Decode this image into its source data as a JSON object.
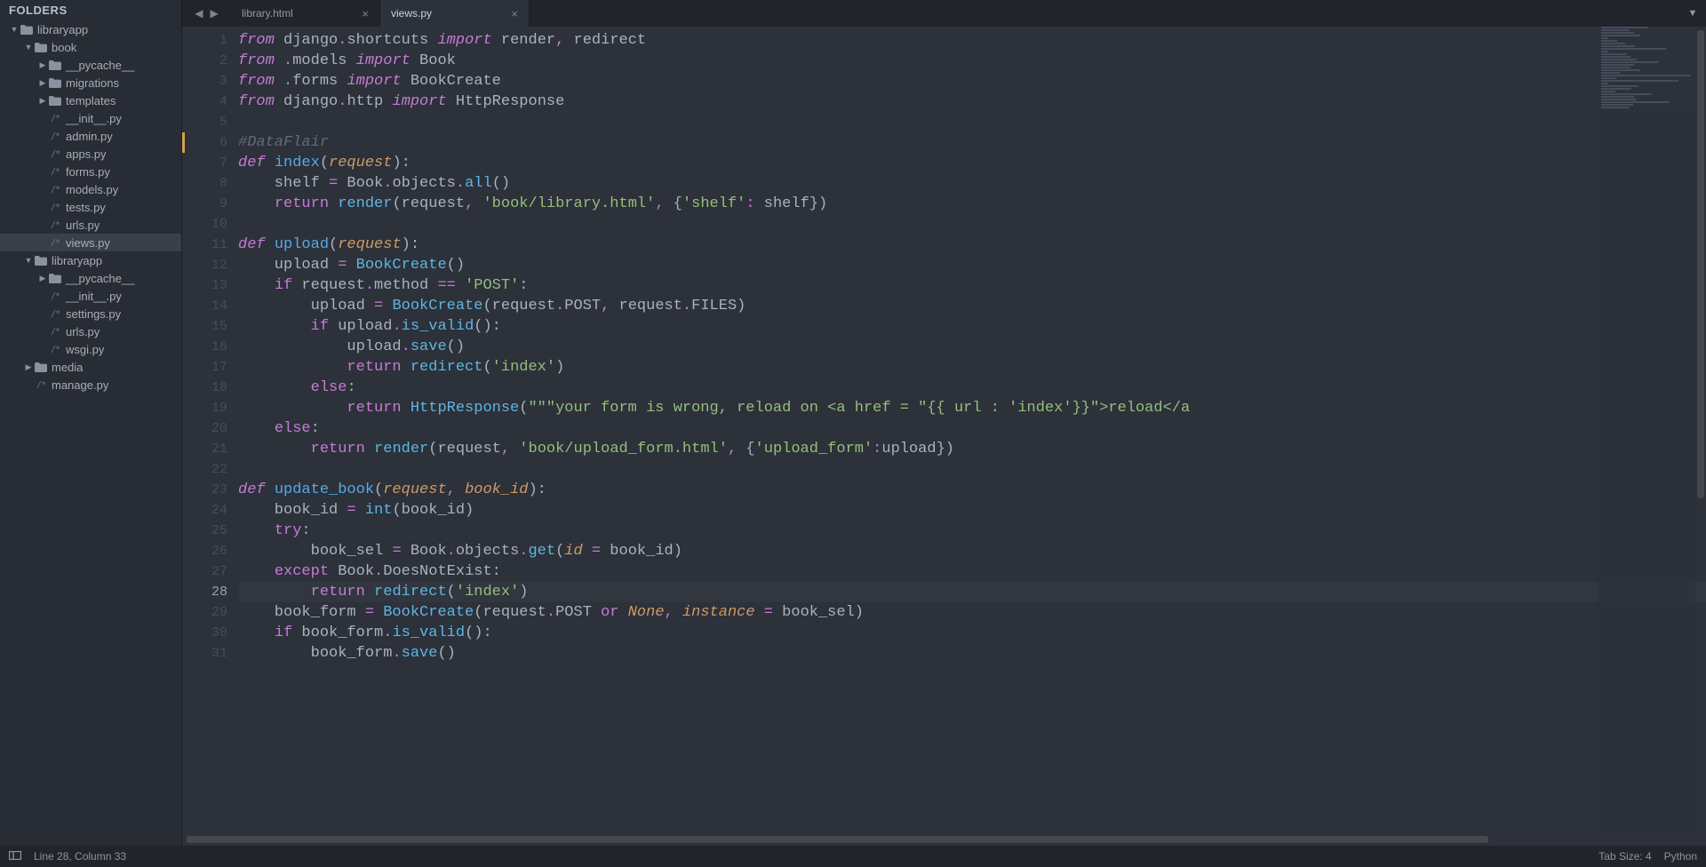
{
  "sidebar": {
    "header": "FOLDERS",
    "tree": [
      {
        "depth": 0,
        "type": "folder",
        "open": true,
        "name": "libraryapp"
      },
      {
        "depth": 1,
        "type": "folder",
        "open": true,
        "name": "book"
      },
      {
        "depth": 2,
        "type": "folder",
        "open": false,
        "name": "__pycache__"
      },
      {
        "depth": 2,
        "type": "folder",
        "open": false,
        "name": "migrations"
      },
      {
        "depth": 2,
        "type": "folder",
        "open": false,
        "name": "templates"
      },
      {
        "depth": 2,
        "type": "file",
        "name": "__init__.py"
      },
      {
        "depth": 2,
        "type": "file",
        "name": "admin.py"
      },
      {
        "depth": 2,
        "type": "file",
        "name": "apps.py"
      },
      {
        "depth": 2,
        "type": "file",
        "name": "forms.py"
      },
      {
        "depth": 2,
        "type": "file",
        "name": "models.py"
      },
      {
        "depth": 2,
        "type": "file",
        "name": "tests.py"
      },
      {
        "depth": 2,
        "type": "file",
        "name": "urls.py"
      },
      {
        "depth": 2,
        "type": "file",
        "name": "views.py",
        "selected": true
      },
      {
        "depth": 1,
        "type": "folder",
        "open": true,
        "name": "libraryapp"
      },
      {
        "depth": 2,
        "type": "folder",
        "open": false,
        "name": "__pycache__"
      },
      {
        "depth": 2,
        "type": "file",
        "name": "__init__.py"
      },
      {
        "depth": 2,
        "type": "file",
        "name": "settings.py"
      },
      {
        "depth": 2,
        "type": "file",
        "name": "urls.py"
      },
      {
        "depth": 2,
        "type": "file",
        "name": "wsgi.py"
      },
      {
        "depth": 1,
        "type": "folder",
        "open": false,
        "name": "media"
      },
      {
        "depth": 1,
        "type": "file",
        "name": "manage.py"
      }
    ]
  },
  "tabs": [
    {
      "label": "library.html",
      "active": false
    },
    {
      "label": "views.py",
      "active": true
    }
  ],
  "status": {
    "cursor": "Line 28, Column 33",
    "tabsize": "Tab Size: 4",
    "lang": "Python"
  },
  "code": {
    "first_line": 1,
    "current_line": 28,
    "lines": [
      [
        [
          "kw",
          "from"
        ],
        [
          "self",
          " django"
        ],
        [
          "op",
          "."
        ],
        [
          "self",
          "shortcuts "
        ],
        [
          "kw",
          "import"
        ],
        [
          "self",
          " render"
        ],
        [
          "op",
          ","
        ],
        [
          "self",
          " redirect"
        ]
      ],
      [
        [
          "kw",
          "from"
        ],
        [
          "self",
          " "
        ],
        [
          "op",
          "."
        ],
        [
          "self",
          "models "
        ],
        [
          "kw",
          "import"
        ],
        [
          "self",
          " Book"
        ]
      ],
      [
        [
          "kw",
          "from"
        ],
        [
          "self",
          " "
        ],
        [
          "op",
          "."
        ],
        [
          "self",
          "forms "
        ],
        [
          "kw",
          "import"
        ],
        [
          "self",
          " BookCreate"
        ]
      ],
      [
        [
          "kw",
          "from"
        ],
        [
          "self",
          " django"
        ],
        [
          "op",
          "."
        ],
        [
          "self",
          "http "
        ],
        [
          "kw",
          "import"
        ],
        [
          "self",
          " HttpResponse"
        ]
      ],
      [
        [
          "self",
          ""
        ]
      ],
      [
        [
          "cmt",
          "#DataFlair"
        ]
      ],
      [
        [
          "kw",
          "def"
        ],
        [
          "self",
          " "
        ],
        [
          "fn",
          "index"
        ],
        [
          "self",
          "("
        ],
        [
          "param",
          "request"
        ],
        [
          "self",
          "):"
        ]
      ],
      [
        [
          "self",
          "    shelf "
        ],
        [
          "op",
          "="
        ],
        [
          "self",
          " Book"
        ],
        [
          "op",
          "."
        ],
        [
          "self",
          "objects"
        ],
        [
          "op",
          "."
        ],
        [
          "call",
          "all"
        ],
        [
          "self",
          "()"
        ]
      ],
      [
        [
          "self",
          "    "
        ],
        [
          "kwn",
          "return"
        ],
        [
          "self",
          " "
        ],
        [
          "call",
          "render"
        ],
        [
          "self",
          "(request"
        ],
        [
          "op",
          ","
        ],
        [
          "self",
          " "
        ],
        [
          "str",
          "'book/library.html'"
        ],
        [
          "op",
          ","
        ],
        [
          "self",
          " {"
        ],
        [
          "str",
          "'shelf'"
        ],
        [
          "op",
          ":"
        ],
        [
          "self",
          " shelf})"
        ]
      ],
      [
        [
          "self",
          ""
        ]
      ],
      [
        [
          "kw",
          "def"
        ],
        [
          "self",
          " "
        ],
        [
          "fn",
          "upload"
        ],
        [
          "self",
          "("
        ],
        [
          "param",
          "request"
        ],
        [
          "self",
          "):"
        ]
      ],
      [
        [
          "self",
          "    upload "
        ],
        [
          "op",
          "="
        ],
        [
          "self",
          " "
        ],
        [
          "call",
          "BookCreate"
        ],
        [
          "self",
          "()"
        ]
      ],
      [
        [
          "self",
          "    "
        ],
        [
          "kwn",
          "if"
        ],
        [
          "self",
          " request"
        ],
        [
          "op",
          "."
        ],
        [
          "self",
          "method "
        ],
        [
          "op",
          "=="
        ],
        [
          "self",
          " "
        ],
        [
          "str",
          "'POST'"
        ],
        [
          "self",
          ":"
        ]
      ],
      [
        [
          "self",
          "        upload "
        ],
        [
          "op",
          "="
        ],
        [
          "self",
          " "
        ],
        [
          "call",
          "BookCreate"
        ],
        [
          "self",
          "(request"
        ],
        [
          "op",
          "."
        ],
        [
          "self",
          "POST"
        ],
        [
          "op",
          ","
        ],
        [
          "self",
          " request"
        ],
        [
          "op",
          "."
        ],
        [
          "self",
          "FILES)"
        ]
      ],
      [
        [
          "self",
          "        "
        ],
        [
          "kwn",
          "if"
        ],
        [
          "self",
          " upload"
        ],
        [
          "op",
          "."
        ],
        [
          "call",
          "is_valid"
        ],
        [
          "self",
          "():"
        ]
      ],
      [
        [
          "self",
          "            upload"
        ],
        [
          "op",
          "."
        ],
        [
          "call",
          "save"
        ],
        [
          "self",
          "()"
        ]
      ],
      [
        [
          "self",
          "            "
        ],
        [
          "kwn",
          "return"
        ],
        [
          "self",
          " "
        ],
        [
          "call",
          "redirect"
        ],
        [
          "self",
          "("
        ],
        [
          "str",
          "'index'"
        ],
        [
          "self",
          ")"
        ]
      ],
      [
        [
          "self",
          "        "
        ],
        [
          "kwn",
          "else"
        ],
        [
          "self",
          ":"
        ]
      ],
      [
        [
          "self",
          "            "
        ],
        [
          "kwn",
          "return"
        ],
        [
          "self",
          " "
        ],
        [
          "call",
          "HttpResponse"
        ],
        [
          "self",
          "("
        ],
        [
          "str",
          "\"\"\"your form is wrong, reload on <a href = \"{{ url : 'index'}}\">reload</a"
        ]
      ],
      [
        [
          "self",
          "    "
        ],
        [
          "kwn",
          "else"
        ],
        [
          "self",
          ":"
        ]
      ],
      [
        [
          "self",
          "        "
        ],
        [
          "kwn",
          "return"
        ],
        [
          "self",
          " "
        ],
        [
          "call",
          "render"
        ],
        [
          "self",
          "(request"
        ],
        [
          "op",
          ","
        ],
        [
          "self",
          " "
        ],
        [
          "str",
          "'book/upload_form.html'"
        ],
        [
          "op",
          ","
        ],
        [
          "self",
          " {"
        ],
        [
          "str",
          "'upload_form'"
        ],
        [
          "op",
          ":"
        ],
        [
          "self",
          "upload})"
        ]
      ],
      [
        [
          "self",
          ""
        ]
      ],
      [
        [
          "kw",
          "def"
        ],
        [
          "self",
          " "
        ],
        [
          "fn",
          "update_book"
        ],
        [
          "self",
          "("
        ],
        [
          "param",
          "request"
        ],
        [
          "op",
          ","
        ],
        [
          "self",
          " "
        ],
        [
          "param",
          "book_id"
        ],
        [
          "self",
          "):"
        ]
      ],
      [
        [
          "self",
          "    book_id "
        ],
        [
          "op",
          "="
        ],
        [
          "self",
          " "
        ],
        [
          "call",
          "int"
        ],
        [
          "self",
          "(book_id)"
        ]
      ],
      [
        [
          "self",
          "    "
        ],
        [
          "kwn",
          "try"
        ],
        [
          "self",
          ":"
        ]
      ],
      [
        [
          "self",
          "        book_sel "
        ],
        [
          "op",
          "="
        ],
        [
          "self",
          " Book"
        ],
        [
          "op",
          "."
        ],
        [
          "self",
          "objects"
        ],
        [
          "op",
          "."
        ],
        [
          "call",
          "get"
        ],
        [
          "self",
          "("
        ],
        [
          "param",
          "id"
        ],
        [
          "self",
          " "
        ],
        [
          "op",
          "="
        ],
        [
          "self",
          " book_id)"
        ]
      ],
      [
        [
          "self",
          "    "
        ],
        [
          "kwn",
          "except"
        ],
        [
          "self",
          " Book"
        ],
        [
          "op",
          "."
        ],
        [
          "self",
          "DoesNotExist:"
        ]
      ],
      [
        [
          "self",
          "        "
        ],
        [
          "kwn",
          "return"
        ],
        [
          "self",
          " "
        ],
        [
          "call",
          "redirect"
        ],
        [
          "self",
          "("
        ],
        [
          "str",
          "'index'"
        ],
        [
          "self",
          ")"
        ]
      ],
      [
        [
          "self",
          "    book_form "
        ],
        [
          "op",
          "="
        ],
        [
          "self",
          " "
        ],
        [
          "call",
          "BookCreate"
        ],
        [
          "self",
          "(request"
        ],
        [
          "op",
          "."
        ],
        [
          "self",
          "POST "
        ],
        [
          "kwn",
          "or"
        ],
        [
          "self",
          " "
        ],
        [
          "const",
          "None"
        ],
        [
          "op",
          ","
        ],
        [
          "self",
          " "
        ],
        [
          "param",
          "instance"
        ],
        [
          "self",
          " "
        ],
        [
          "op",
          "="
        ],
        [
          "self",
          " book_sel)"
        ]
      ],
      [
        [
          "self",
          "    "
        ],
        [
          "kwn",
          "if"
        ],
        [
          "self",
          " book_form"
        ],
        [
          "op",
          "."
        ],
        [
          "call",
          "is_valid"
        ],
        [
          "self",
          "():"
        ]
      ],
      [
        [
          "self",
          "        book_form"
        ],
        [
          "op",
          "."
        ],
        [
          "call",
          "save"
        ],
        [
          "self",
          "()"
        ]
      ]
    ]
  }
}
